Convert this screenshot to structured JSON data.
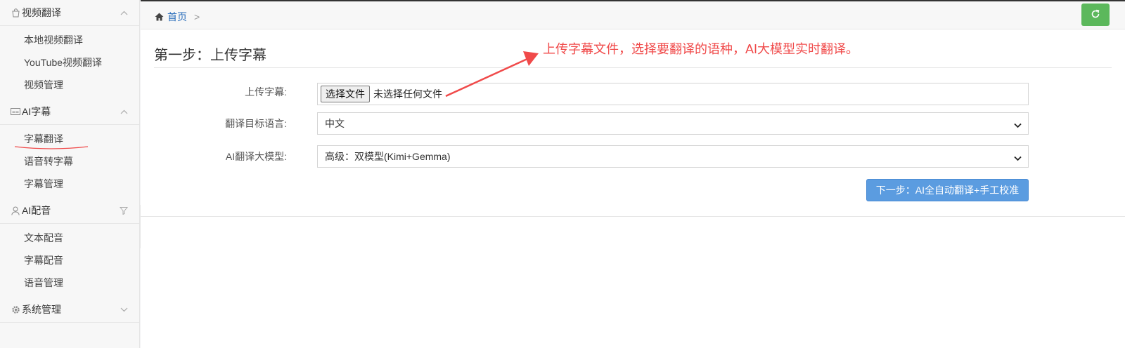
{
  "sidebar": {
    "groups": [
      {
        "label": "视频翻译",
        "icon": "shopping-bag-icon",
        "arrow": "chevron-up-icon",
        "items": [
          "本地视频翻译",
          "YouTube视频翻译",
          "视频管理"
        ]
      },
      {
        "label": "AI字幕",
        "icon": "subtitle-icon",
        "arrow": "chevron-up-icon",
        "items": [
          "字幕翻译",
          "语音转字幕",
          "字幕管理"
        ]
      },
      {
        "label": "AI配音",
        "icon": "user-icon",
        "arrow": "filter-icon",
        "items": [
          "文本配音",
          "字幕配音",
          "语音管理"
        ]
      },
      {
        "label": "系统管理",
        "icon": "gear-icon",
        "arrow": "chevron-down-icon",
        "items": []
      }
    ],
    "active_item": "字幕翻译"
  },
  "breadcrumb": {
    "home": "首页",
    "sep": ">"
  },
  "page": {
    "title": "第一步：上传字幕"
  },
  "form": {
    "upload_label": "上传字幕:",
    "file_button": "选择文件",
    "file_status": "未选择任何文件",
    "lang_label": "翻译目标语言:",
    "lang_value": "中文",
    "model_label": "AI翻译大模型:",
    "model_value": "高级：双模型(Kimi+Gemma)",
    "next_button": "下一步：AI全自动翻译+手工校准"
  },
  "annotation": {
    "text": "上传字幕文件，选择要翻译的语种，AI大模型实时翻译。",
    "color": "#f04a4a"
  },
  "colors": {
    "refresh": "#5cb85c",
    "primary": "#5b9ce0",
    "link": "#2a6ebb"
  }
}
